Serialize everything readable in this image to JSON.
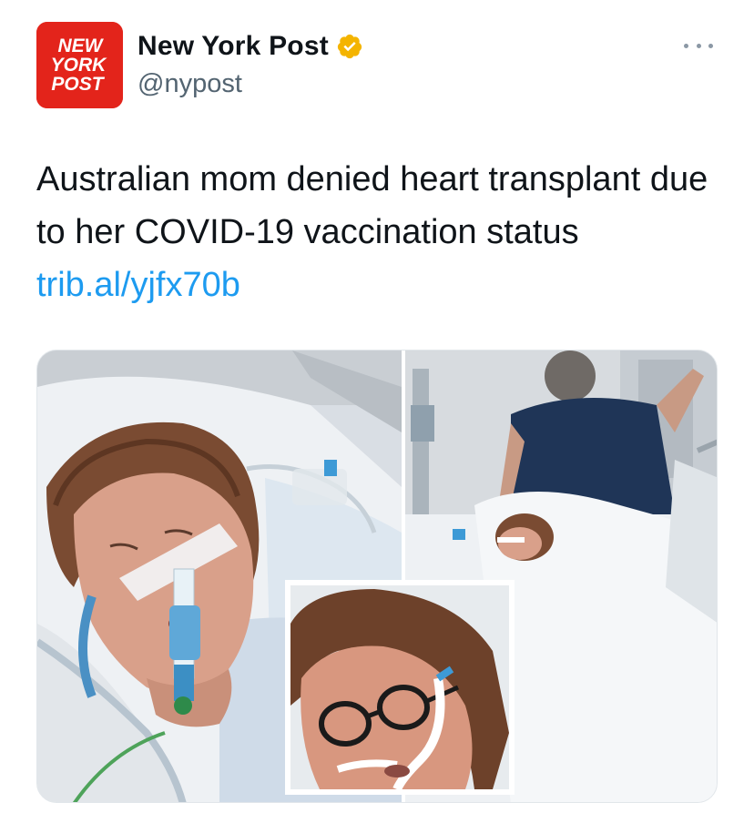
{
  "author": {
    "display_name": "New York Post",
    "handle": "@nypost",
    "avatar_logo_text": [
      "NEW",
      "YORK",
      "POST"
    ],
    "avatar_color": "#e3241b",
    "verified_badge_color": "#f4b400",
    "verified_icon": "gold-verified-badge-icon"
  },
  "menu": {
    "icon": "more-options-icon"
  },
  "tweet": {
    "text": "Australian mom denied heart transplant due to her COVID-19 vaccination status ",
    "link_text": "trib.al/yjfx70b",
    "link_color": "#1d9bf0"
  },
  "media": {
    "description_icon": "photo-collage"
  }
}
